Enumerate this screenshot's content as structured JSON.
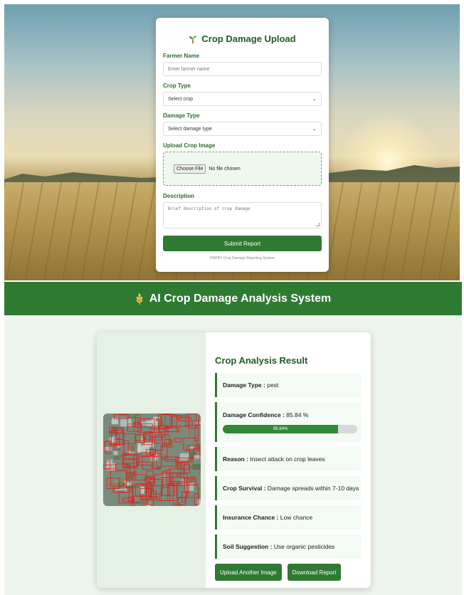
{
  "form": {
    "title": "Crop Damage Upload",
    "icon": "sprout-icon",
    "farmer_label": "Farmer Name",
    "farmer_placeholder": "Enter farmer name",
    "crop_label": "Crop Type",
    "crop_value": "Select crop",
    "damage_label": "Damage Type",
    "damage_value": "Select damage type",
    "upload_label": "Upload Crop Image",
    "choose_file": "Choose File",
    "no_file": "No file chosen",
    "description_label": "Description",
    "description_placeholder": "Brief description of crop damage",
    "submit_label": "Submit Report",
    "footer": "PMFBY Crop Damage Reporting System"
  },
  "ai_header": {
    "title": "AI Crop Damage Analysis System",
    "icon": "wheat-icon"
  },
  "result": {
    "title": "Crop Analysis Result",
    "damage_type_label": "Damage Type :",
    "damage_type_value": "pest",
    "confidence_label": "Damage Confidence :",
    "confidence_value": "85.84 %",
    "confidence_bar_text": "85.84%",
    "confidence_fraction": 0.8584,
    "reason_label": "Reason :",
    "reason_value": "Insect attack on crop leaves",
    "survival_label": "Crop Survival :",
    "survival_value": "Damage spreads within 7-10 days",
    "insurance_label": "Insurance Chance :",
    "insurance_value": "Low chance",
    "soil_label": "Soil Suggestion :",
    "soil_value": "Use organic pesticides",
    "upload_another": "Upload Another Image",
    "download_report": "Download Report"
  },
  "colors": {
    "primary_green": "#2f7a32",
    "dark_green_text": "#1f5b22",
    "detection_red": "#e02020"
  }
}
